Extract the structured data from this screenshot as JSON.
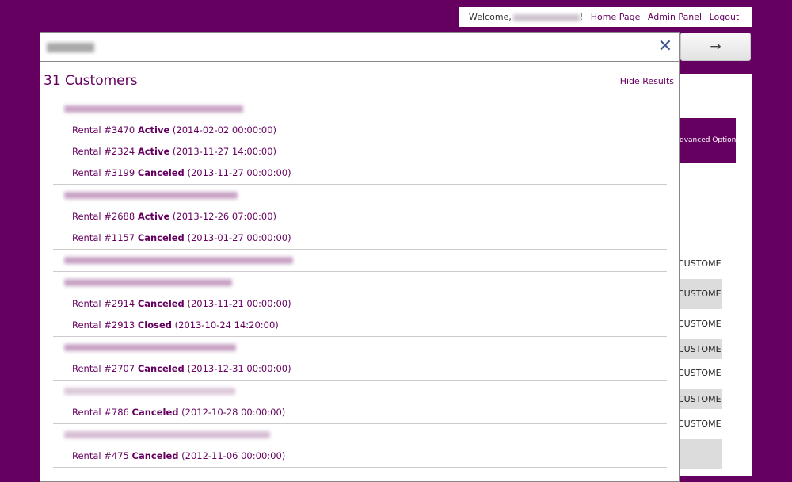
{
  "topnav": {
    "welcome": "Welcome,",
    "exclaim": "!",
    "home": "Home Page",
    "admin": "Admin Panel",
    "logout": "Logout"
  },
  "go_button": {
    "label": "→"
  },
  "search": {
    "close_glyph": "✕",
    "icon": "close-icon"
  },
  "background": {
    "advanced_options": "Advanced Options",
    "customer_label": "CUSTOMER"
  },
  "results": {
    "title": "31 Customers",
    "hide_label": "Hide Results",
    "customers": [
      {
        "rentals": [
          {
            "prefix": "Rental #3470",
            "status": "Active",
            "date": "(2014-02-02 00:00:00)"
          },
          {
            "prefix": "Rental #2324",
            "status": "Active",
            "date": "(2013-11-27 14:00:00)"
          },
          {
            "prefix": "Rental #3199",
            "status": "Canceled",
            "date": "(2013-11-27 00:00:00)"
          }
        ]
      },
      {
        "rentals": [
          {
            "prefix": "Rental #2688",
            "status": "Active",
            "date": "(2013-12-26 07:00:00)"
          },
          {
            "prefix": "Rental #1157",
            "status": "Canceled",
            "date": "(2013-01-27 00:00:00)"
          }
        ]
      },
      {
        "rentals": []
      },
      {
        "rentals": [
          {
            "prefix": "Rental #2914",
            "status": "Canceled",
            "date": "(2013-11-21 00:00:00)"
          },
          {
            "prefix": "Rental #2913",
            "status": "Closed",
            "date": "(2013-10-24 14:20:00)"
          }
        ]
      },
      {
        "rentals": [
          {
            "prefix": "Rental #2707",
            "status": "Canceled",
            "date": "(2013-12-31 00:00:00)"
          }
        ]
      },
      {
        "rentals": [
          {
            "prefix": "Rental #786",
            "status": "Canceled",
            "date": "(2012-10-28 00:00:00)"
          }
        ]
      },
      {
        "rentals": [
          {
            "prefix": "Rental #475",
            "status": "Canceled",
            "date": "(2012-11-06 00:00:00)"
          }
        ]
      }
    ]
  },
  "colors": {
    "brand": "#650060",
    "close_icon": "#3a5a8c"
  }
}
